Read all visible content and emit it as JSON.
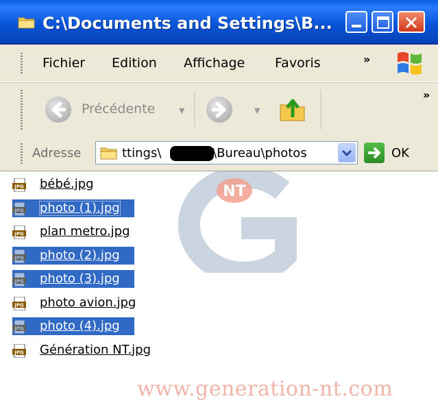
{
  "window": {
    "title": "C:\\Documents and Settings\\B...",
    "controls": [
      "minimize",
      "maximize",
      "close"
    ]
  },
  "menubar": {
    "items": [
      "Fichier",
      "Edition",
      "Affichage",
      "Favoris"
    ],
    "overflow": "»"
  },
  "toolbar": {
    "back_label": "Précédente",
    "overflow": "»"
  },
  "address": {
    "label": "Adresse",
    "value_prefix": "ttings\\",
    "value_suffix": "\\Bureau\\photos",
    "go_label": "OK"
  },
  "files": [
    {
      "name": "bébé.jpg",
      "selected": false
    },
    {
      "name": "photo (1).jpg",
      "selected": true
    },
    {
      "name": "plan metro.jpg",
      "selected": false
    },
    {
      "name": "photo (2).jpg",
      "selected": true
    },
    {
      "name": "photo (3).jpg",
      "selected": true
    },
    {
      "name": "photo avion.jpg",
      "selected": false
    },
    {
      "name": "photo (4).jpg",
      "selected": true
    },
    {
      "name": "Génération NT.jpg",
      "selected": false
    }
  ],
  "icons": {
    "file": "jpg-file-icon",
    "folder": "folder-icon",
    "back": "back-arrow-icon",
    "forward": "forward-arrow-icon",
    "up": "folder-up-icon",
    "go": "go-arrow-icon",
    "logo": "windows-logo-icon"
  },
  "watermark": {
    "logo_text": "NT",
    "url": "www.generation-nt.com"
  },
  "colors": {
    "titlebar": "#0a55d8",
    "selection": "#316ac5",
    "chrome": "#ece9d8",
    "close_button": "#d4381b"
  }
}
